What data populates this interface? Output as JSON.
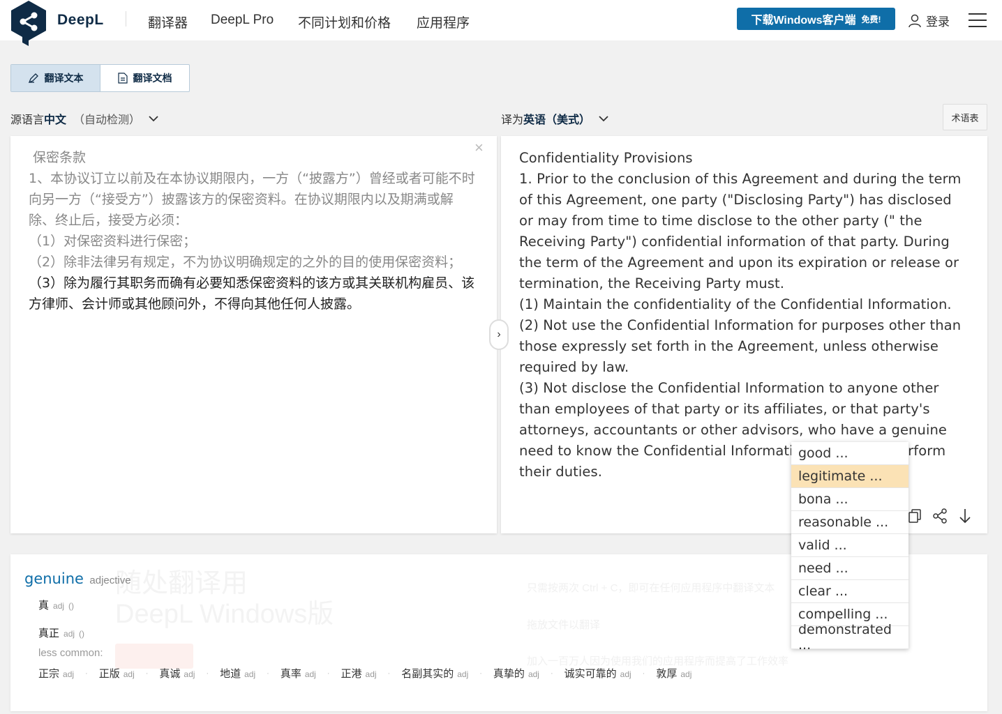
{
  "header": {
    "brand": "DeepL",
    "nav": [
      "翻译器",
      "DeepL Pro",
      "不同计划和价格",
      "应用程序"
    ],
    "download_label": "下载Windows客户端",
    "download_free": "免费!",
    "login_label": "登录"
  },
  "mode_tabs": {
    "text_label": "翻译文本",
    "doc_label": "翻译文档"
  },
  "source": {
    "prefix": "源语言",
    "language": "中文",
    "auto": "（自动检测）",
    "paragraphs": [
      " 保密条款",
      "1、本协议订立以前及在本协议期限内，一方（“披露方”）曾经或者可能不时向另一方（“接受方”）披露该方的保密资料。在协议期限内以及期满或解除、终止后，接受方必须：",
      "（1）对保密资料进行保密；",
      "（2）除非法律另有规定，不为协议明确规定的之外的目的使用保密资料；",
      "（3）除为履行其职务而确有必要知悉保密资料的该方或其关联机构雇员、该方律师、会计师或其他顾问外，不得向其他任何人披露。"
    ]
  },
  "target": {
    "prefix": "译为",
    "language": "英语（美式）",
    "glossary_label": "术语表",
    "paragraphs": [
      " Confidentiality Provisions",
      "1. Prior to the conclusion of this Agreement and during the term of this Agreement, one party (\"Disclosing Party\") has disclosed or may from time to time disclose to the other party (\" the Receiving Party\") confidential information of that party. During the term of the Agreement and upon its expiration or release or termination, the Receiving Party must.",
      "(1) Maintain the confidentiality of the Confidential Information.",
      "(2) Not use the Confidential Information for purposes other than those expressly set forth in the Agreement, unless otherwise required by law.",
      "(3) Not disclose the Confidential Information to anyone other than employees of that party or its affiliates, or that party's attorneys, accountants or other advisors, who have a genuine need to know the Confidential Information in order to perform their duties."
    ]
  },
  "alternatives": [
    "good ...",
    "legitimate ...",
    "bona ...",
    "reasonable ...",
    "valid ...",
    "need ...",
    "clear ...",
    "compelling ...",
    "demonstrated ..."
  ],
  "dictionary": {
    "word": "genuine",
    "pos": "adjective",
    "entries": [
      {
        "word": "真",
        "tag": "adj",
        "extra": "()"
      },
      {
        "word": "真正",
        "tag": "adj",
        "extra": "()"
      }
    ],
    "less_common_label": "less common:",
    "less_common": [
      {
        "word": "正宗",
        "tag": "adj"
      },
      {
        "word": "正版",
        "tag": "adj"
      },
      {
        "word": "真诚",
        "tag": "adj"
      },
      {
        "word": "地道",
        "tag": "adj"
      },
      {
        "word": "真率",
        "tag": "adj"
      },
      {
        "word": "正港",
        "tag": "adj"
      },
      {
        "word": "名副其实的",
        "tag": "adj"
      },
      {
        "word": "真挚的",
        "tag": "adj"
      },
      {
        "word": "诚实可靠的",
        "tag": "adj"
      },
      {
        "word": "敦厚",
        "tag": "adj"
      }
    ],
    "background_title": [
      "随处翻译用",
      "DeepL Windows版"
    ],
    "background_lines": [
      "只需按两次 Ctrl + C，即可在任何应用程序中翻译文本",
      "拖放文件以翻译",
      "加入一百万人因为使用我们的应用程序而提高了工作效率"
    ]
  }
}
